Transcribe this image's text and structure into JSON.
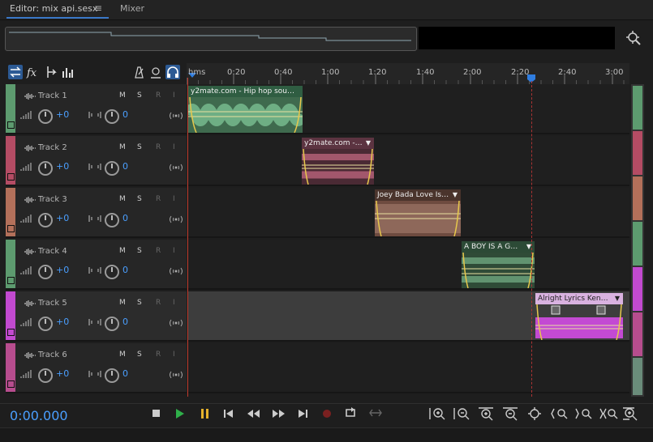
{
  "tabs": {
    "editor": "Editor: mix api.sesx",
    "menu_icon": "≡",
    "mixer": "Mixer"
  },
  "ruler": {
    "labels": [
      "hms",
      "0:20",
      "0:40",
      "1:00",
      "1:20",
      "1:40",
      "2:00",
      "2:20",
      "2:40",
      "3:00"
    ]
  },
  "tracks": [
    {
      "name": "Track 1",
      "vol": "+0",
      "pan": "0",
      "color": "#5d9b6f",
      "clip": "y2mate.com - Hip hop sou…",
      "clip_color": "#4d7a5c"
    },
    {
      "name": "Track 2",
      "vol": "+0",
      "pan": "0",
      "color": "#b44c64",
      "clip": "y2mate.com -…",
      "clip_color": "#7a3d4b"
    },
    {
      "name": "Track 3",
      "vol": "+0",
      "pan": "0",
      "color": "#b3705a",
      "clip": "Joey Bada  Love Is…",
      "clip_color": "#7e5546"
    },
    {
      "name": "Track 4",
      "vol": "+0",
      "pan": "0",
      "color": "#5d9b6f",
      "clip": "A BOY IS A G…",
      "clip_color": "#4a7a57"
    },
    {
      "name": "Track 5",
      "vol": "+0",
      "pan": "0",
      "color": "#c24ad0",
      "clip": "Alright Lyrics  Ken…",
      "clip_color": "#a43fb6"
    },
    {
      "name": "Track 6",
      "vol": "+0",
      "pan": "0",
      "color": "#b74d8e",
      "clip": "",
      "clip_color": ""
    }
  ],
  "track_buttons": {
    "m": "M",
    "s": "S",
    "r": "R",
    "i": "I"
  },
  "transport": {
    "timecode": "0:00.000"
  },
  "icons": [
    "swap-icon",
    "fx-icon",
    "merge-icon",
    "bars-icon",
    "metronome-icon",
    "record-arm-icon",
    "headphones-icon",
    "zoom-nav-icon",
    "stop-icon",
    "play-icon",
    "pause-icon",
    "skip-start-icon",
    "rewind-icon",
    "fast-forward-icon",
    "skip-end-icon",
    "record-icon",
    "loop-icon",
    "skip-selection-icon"
  ]
}
